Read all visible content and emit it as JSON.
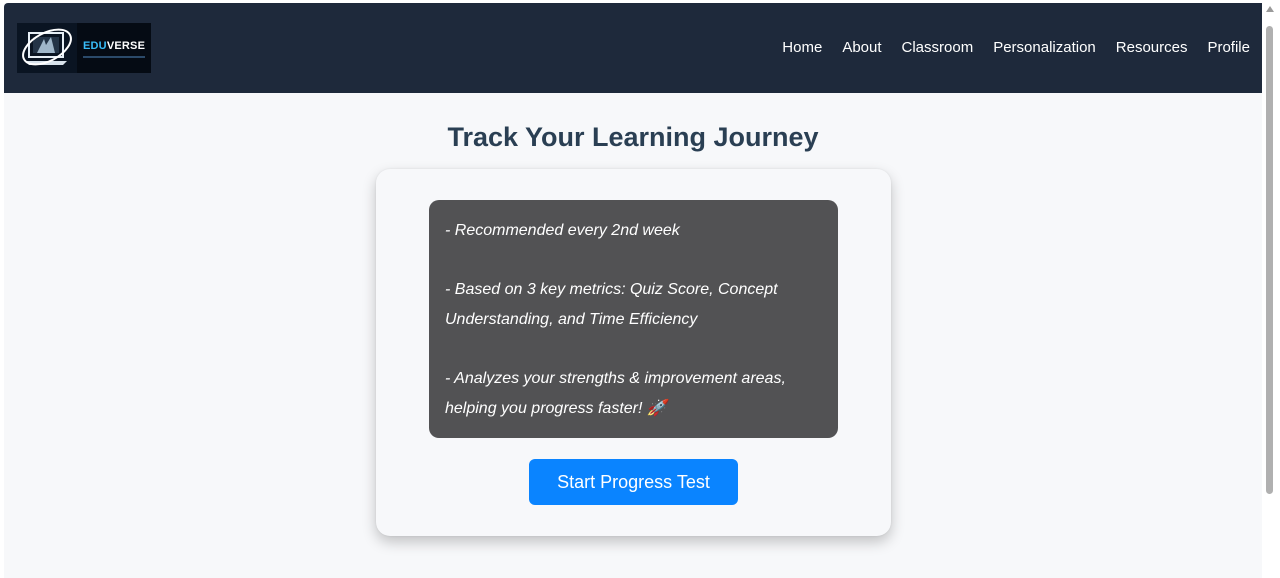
{
  "brand": {
    "name_highlight": "EDU",
    "name_rest": "VERSE"
  },
  "nav": {
    "items": [
      "Home",
      "About",
      "Classroom",
      "Personalization",
      "Resources",
      "Profile"
    ]
  },
  "main": {
    "title": "Track Your Learning Journey",
    "info_lines": [
      "- Recommended every 2nd week",
      "- Based on 3 key metrics: Quiz Score, Concept Understanding, and Time Efficiency",
      "- Analyzes your strengths & improvement areas, helping you progress faster! 🚀"
    ],
    "start_button": "Start Progress Test"
  },
  "colors": {
    "navbar": "#1e293b",
    "info_box": "#525254",
    "primary_button": "#0a84ff",
    "title": "#2a3f53"
  }
}
